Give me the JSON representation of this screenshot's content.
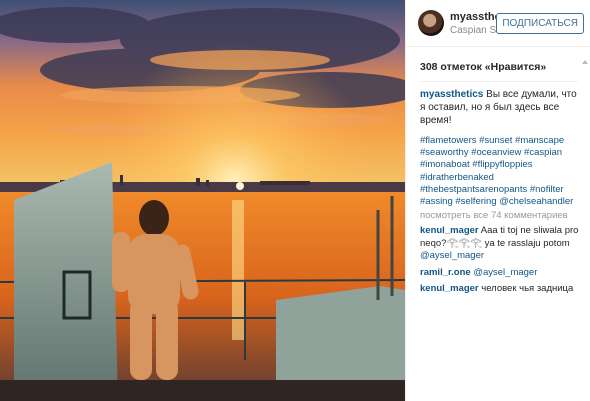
{
  "post": {
    "username": "myassthetics",
    "username_trunc": "myassthetі...",
    "location": "Caspian S...",
    "follow_label": "ПОДПИСАТЬСЯ",
    "likes": "308 отметок «Нравится»",
    "caption_user": "myassthetics",
    "caption_text": "Вы все думали, что я оставил, но я был здесь все время!",
    "hashtags": "#flametowers #sunset #manscape #seaworthy #oceanview #caspian #imonaboat #flippyfloppies #idratherbenaked #thebestpantsarenopants #nofilter #assing #selfering @chelseahandler",
    "view_all": "посмотреть все 74 комментариев",
    "comments": [
      {
        "user": "kenul_mager",
        "text": "Aaa ti toj ne sliwala pro neqo?𓂀𓂀𓂀 ya te rasslaju potom",
        "mention": "@aysel_mager"
      },
      {
        "user": "ramil_r.one",
        "text": "",
        "mention": "@aysel_mager"
      },
      {
        "user": "kenul_mager",
        "text": "человек чья задница",
        "mention": ""
      }
    ]
  },
  "colors": {
    "link": "#125688",
    "follow": "#3f729b",
    "text": "#262626",
    "muted": "#999999"
  }
}
